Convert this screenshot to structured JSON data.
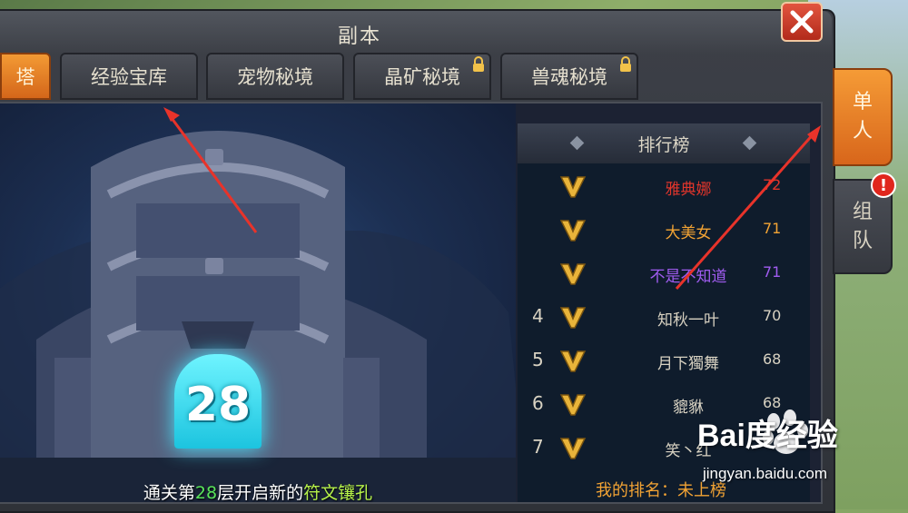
{
  "window": {
    "title": "副本"
  },
  "tabs": [
    {
      "label": "塔",
      "active": true,
      "locked": false
    },
    {
      "label": "经验宝库",
      "active": false,
      "locked": false
    },
    {
      "label": "宠物秘境",
      "active": false,
      "locked": false
    },
    {
      "label": "晶矿秘境",
      "active": false,
      "locked": true
    },
    {
      "label": "兽魂秘境",
      "active": false,
      "locked": true
    }
  ],
  "tower": {
    "current_level": "28",
    "caption_prefix": "通关第",
    "caption_level": "28",
    "caption_middle": "层开启新的",
    "caption_highlight": "符文镶孔"
  },
  "ranking": {
    "title": "排行榜",
    "rows": [
      {
        "rank": "",
        "name": "雅典娜",
        "score": "72",
        "color": "#e0352b"
      },
      {
        "rank": "",
        "name": "大美女",
        "score": "71",
        "color": "#f2a334"
      },
      {
        "rank": "",
        "name": "不是不知道",
        "score": "71",
        "color": "#a05cf0"
      },
      {
        "rank": "4",
        "name": "知秋一叶",
        "score": "70",
        "color": "#d8d2c2"
      },
      {
        "rank": "5",
        "name": "月下獨舞",
        "score": "68",
        "color": "#d8d2c2"
      },
      {
        "rank": "6",
        "name": "貔貅",
        "score": "68",
        "color": "#d8d2c2"
      },
      {
        "rank": "7",
        "name": "笑丶红",
        "score": "",
        "color": "#d8d2c2"
      }
    ],
    "my_rank_label": "我的排名：",
    "my_rank_value": "未上榜"
  },
  "side_tabs": {
    "single": "单人",
    "team": "组队",
    "team_alert": "!"
  },
  "watermark": {
    "brand": "Bai度经验",
    "url": "jingyan.baidu.com"
  },
  "colors": {
    "accent": "#f39a34",
    "close": "#c8382a",
    "level_glow": "#47e6ff"
  }
}
